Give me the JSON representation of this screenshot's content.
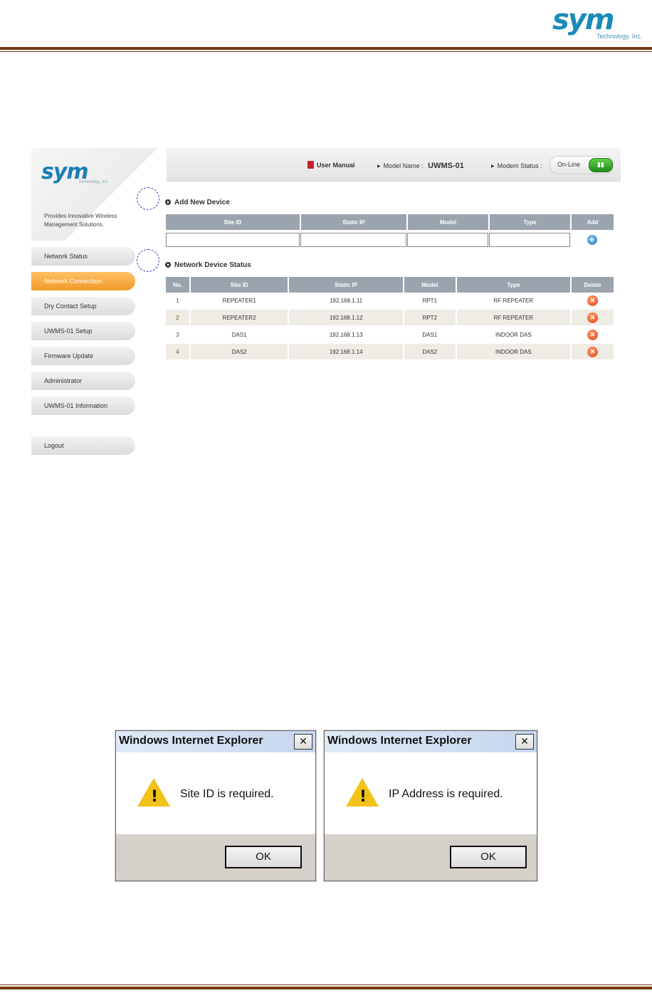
{
  "page": {
    "brand_logo": "sym",
    "brand_sub": "Technology, Inc."
  },
  "app": {
    "logo": "sym",
    "logo_sub": "Technology, Inc.",
    "tagline": "Provides Innovative Wireless Management Solutions.",
    "header": {
      "user_manual": "User Manual",
      "model_name_label": "Model Name :",
      "model_name_value": "UWMS-01",
      "modem_status_label": "Modem Status :",
      "modem_status_value": "On-Line"
    },
    "menu": [
      {
        "label": "Network Status"
      },
      {
        "label": "Network Connection",
        "active": true
      },
      {
        "label": "Dry Contact Setup"
      },
      {
        "label": "UWMS-01 Setup"
      },
      {
        "label": "Firmware Update"
      },
      {
        "label": "Administrator"
      },
      {
        "label": "UWMS-01 Information"
      },
      {
        "label": "Logout"
      }
    ],
    "add_device": {
      "title": "Add New Device",
      "columns": [
        "Site ID",
        "Static IP",
        "Model",
        "Type",
        "Add"
      ]
    },
    "device_status": {
      "title": "Network Device Status",
      "columns": [
        "No.",
        "Site ID",
        "Static IP",
        "Model",
        "Type",
        "Delete"
      ],
      "rows": [
        {
          "no": "1",
          "site_id": "REPEATER1",
          "ip": "192.168.1.11",
          "model": "RPT1",
          "type": "RF REPEATER"
        },
        {
          "no": "2",
          "site_id": "REPEATER2",
          "ip": "192.168.1.12",
          "model": "RPT2",
          "type": "RF REPEATER"
        },
        {
          "no": "3",
          "site_id": "DAS1",
          "ip": "192.168.1.13",
          "model": "DAS1",
          "type": "INDOOR DAS"
        },
        {
          "no": "4",
          "site_id": "DAS2",
          "ip": "192.168.1.14",
          "model": "DAS2",
          "type": "INDOOR DAS"
        }
      ]
    }
  },
  "dialogs": [
    {
      "title": "Windows Internet Explorer",
      "message": "Site ID is required.",
      "ok": "OK",
      "close": "✕"
    },
    {
      "title": "Windows Internet Explorer",
      "message": "IP Address is required.",
      "ok": "OK",
      "close": "✕"
    }
  ]
}
